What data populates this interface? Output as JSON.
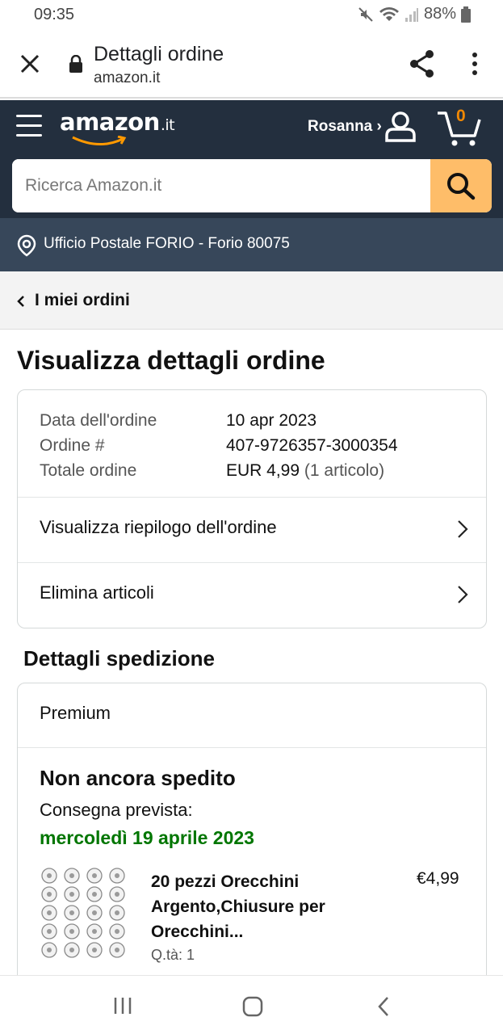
{
  "status_bar": {
    "time": "09:35",
    "battery": "88%"
  },
  "browser": {
    "title": "Dettagli ordine",
    "domain": "amazon.it"
  },
  "header": {
    "logo_text": "amazon",
    "logo_tld": ".it",
    "account_label": "Rosanna ›",
    "cart_count": "0",
    "search_placeholder": "Ricerca Amazon.it",
    "location": "Ufficio Postale FORIO - Forio 80075"
  },
  "breadcrumb": {
    "label": "I miei ordini"
  },
  "page": {
    "heading": "Visualizza dettagli ordine",
    "summary": {
      "rows": [
        {
          "label": "Data dell'ordine",
          "value": "10 apr 2023",
          "extra": ""
        },
        {
          "label": "Ordine #",
          "value": "407-9726357-3000354",
          "extra": ""
        },
        {
          "label": "Totale ordine",
          "value": "EUR 4,99",
          "extra": "(1 articolo)"
        }
      ],
      "links": [
        "Visualizza riepilogo dell'ordine",
        "Elimina articoli"
      ]
    },
    "shipping": {
      "heading": "Dettagli spedizione",
      "type": "Premium",
      "status": "Non ancora spedito",
      "eta_label": "Consegna prevista:",
      "eta_date": "mercoledì 19 aprile 2023",
      "item": {
        "title": "20 pezzi Orecchini Argento,Chiusure per Orecchini...",
        "price": "€4,99",
        "qty": "Q.tà: 1"
      }
    }
  },
  "colors": {
    "header_bg": "#232f3e",
    "location_bg": "#37475a",
    "search_button": "#febd69",
    "delivery_green": "#007600",
    "cart_accent": "#f08804"
  },
  "icons": [
    "close-icon",
    "lock-icon",
    "share-icon",
    "more-vert-icon",
    "hamburger-icon",
    "user-icon",
    "cart-icon",
    "search-icon",
    "location-pin-icon",
    "chevron-left-icon",
    "chevron-right-icon",
    "recent-apps-icon",
    "home-icon",
    "back-icon"
  ]
}
